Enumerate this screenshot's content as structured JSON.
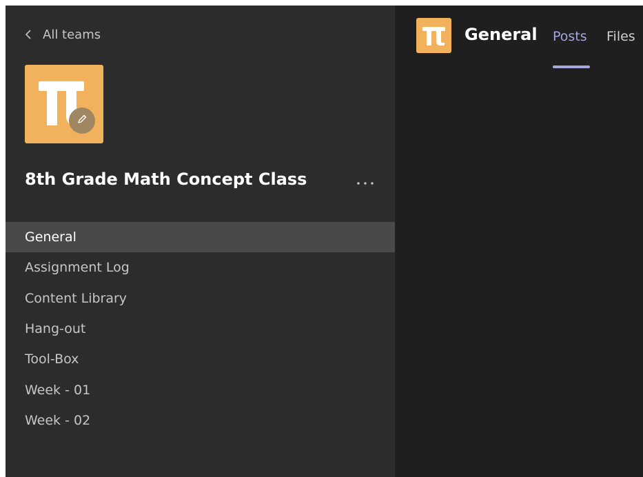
{
  "colors": {
    "sidebar_bg": "#2d2c2c",
    "main_bg": "#1f1f1f",
    "accent_purple": "#a6a7dc",
    "team_orange": "#f2b15d",
    "active_channel_bg": "#4a4948"
  },
  "sidebar": {
    "back_label": "All teams",
    "back_icon": "chevron-left-icon",
    "team_avatar_icon": "pi-icon",
    "team_avatar_edit_icon": "pencil-icon",
    "team_name": "8th Grade Math Concept Class",
    "more_icon": "ellipsis-icon",
    "channels": [
      {
        "label": "General",
        "active": true
      },
      {
        "label": "Assignment Log",
        "active": false
      },
      {
        "label": "Content Library",
        "active": false
      },
      {
        "label": "Hang-out",
        "active": false
      },
      {
        "label": "Tool-Box",
        "active": false
      },
      {
        "label": "Week - 01",
        "active": false
      },
      {
        "label": "Week - 02",
        "active": false
      }
    ]
  },
  "header": {
    "channel_icon": "pi-icon",
    "channel_title": "General",
    "tabs": [
      {
        "label": "Posts",
        "active": true
      },
      {
        "label": "Files",
        "active": false
      }
    ]
  }
}
